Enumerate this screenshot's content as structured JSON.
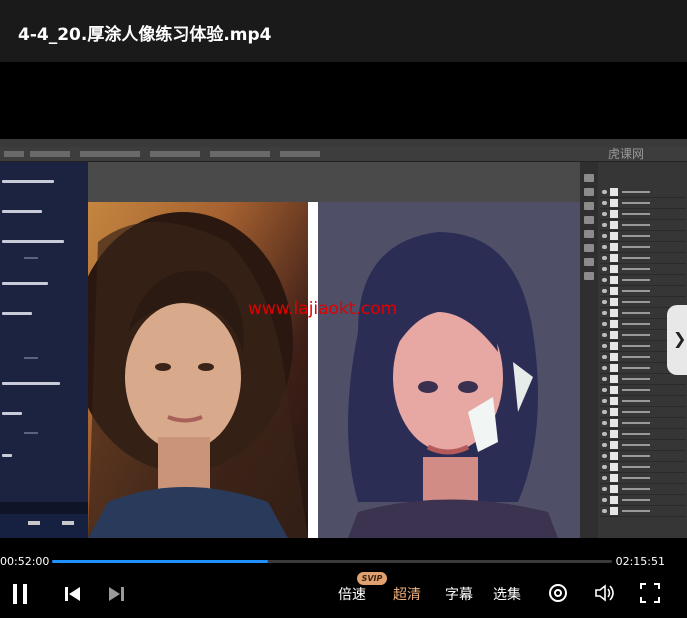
{
  "header": {
    "title": "4-4_20.厚涂人像练习体验.mp4"
  },
  "video": {
    "watermark_site": "www.lajiaokt.com",
    "ps_watermark": "虎课网"
  },
  "player": {
    "current_time": "00:52:00",
    "duration": "02:15:51",
    "progress": 0.385,
    "speed_label": "倍速",
    "speed_badge": "SVIP",
    "quality_label": "超清",
    "subtitle_label": "字幕",
    "episodes_label": "选集"
  },
  "colors": {
    "accent": "#1e90ff",
    "quality": "#f0b07a",
    "badge": "#e0a070"
  },
  "icons": [
    "pause-icon",
    "prev-icon",
    "next-icon",
    "danmaku-icon",
    "volume-icon",
    "fullscreen-icon",
    "chevron-right-icon"
  ]
}
